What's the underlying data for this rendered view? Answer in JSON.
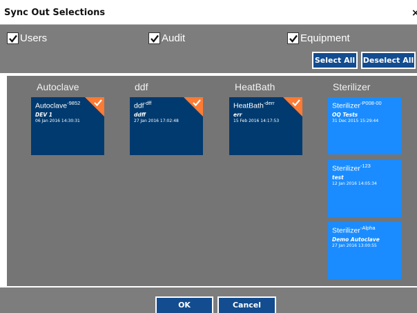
{
  "dialog": {
    "title": "Sync Out Selections",
    "close": "×"
  },
  "filters": [
    {
      "label": "Users",
      "checked": true
    },
    {
      "label": "Audit",
      "checked": true
    },
    {
      "label": "Equipment",
      "checked": true
    }
  ],
  "buttons": {
    "select_all": "Select All",
    "deselect_all": "Deselect All",
    "ok": "OK",
    "cancel": "Cancel"
  },
  "columns": [
    {
      "header": "Autoclave",
      "items": [
        {
          "name": "Autoclave",
          "suffix": "-9852",
          "desc": "DEV 1",
          "date": "06 Jan 2016 14:30:31",
          "selected": true
        }
      ]
    },
    {
      "header": "ddf",
      "items": [
        {
          "name": "ddf",
          "suffix": "-dff",
          "desc": "ddff",
          "date": "27 Jan 2016 17:02:48",
          "selected": true
        }
      ]
    },
    {
      "header": "HeatBath",
      "items": [
        {
          "name": "HeatBath",
          "suffix": "-derr",
          "desc": "err",
          "date": "15 Feb 2016 14:17:53",
          "selected": true
        }
      ]
    },
    {
      "header": "Sterilizer",
      "items": [
        {
          "name": "Sterilizer",
          "suffix": "-P008-00",
          "desc": "OQ Tests",
          "date": "31 Dec 2015 15:29:44",
          "selected": false
        },
        {
          "name": "Sterilizer",
          "suffix": "-123",
          "desc": "test",
          "date": "12 Jan 2016 14:05:34",
          "selected": false
        },
        {
          "name": "Sterilizer",
          "suffix": "-Alpha",
          "desc": "Demo Autoclave",
          "date": "27 Jan 2016 13:00:55",
          "selected": false
        }
      ]
    }
  ],
  "colors": {
    "selected_tile": "#003a6f",
    "unselected_tile": "#1a8cff",
    "check_corner": "#ff7a33",
    "panel": "#757575",
    "button": "#134c8f"
  }
}
